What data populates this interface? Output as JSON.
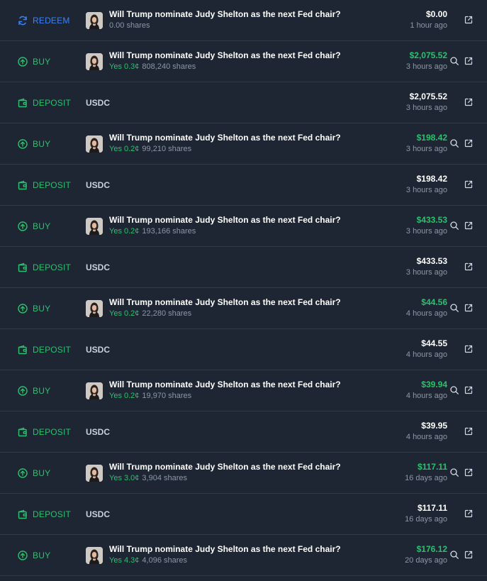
{
  "market_title": "Will Trump nominate Judy Shelton as the next Fed chair?",
  "colors": {
    "buy": "#27c26b",
    "deposit": "#27c26b",
    "redeem": "#3b82f6",
    "text": "#ffffff",
    "muted": "#8b97a8"
  },
  "rows": [
    {
      "type": "redeem",
      "label": "REDEEM",
      "icon": "refresh-icon",
      "title": "Will Trump nominate Judy Shelton as the next Fed chair?",
      "outcome": "",
      "shares": "0.00 shares",
      "amount": "$0.00",
      "time": "1 hour ago"
    },
    {
      "type": "buy",
      "label": "BUY",
      "icon": "arrow-up-circle-icon",
      "title": "Will Trump nominate Judy Shelton as the next Fed chair?",
      "outcome": "Yes 0.3¢",
      "shares": "808,240 shares",
      "amount": "$2,075.52",
      "time": "3 hours ago"
    },
    {
      "type": "deposit",
      "label": "DEPOSIT",
      "icon": "wallet-icon",
      "asset": "USDC",
      "amount": "$2,075.52",
      "time": "3 hours ago"
    },
    {
      "type": "buy",
      "label": "BUY",
      "icon": "arrow-up-circle-icon",
      "title": "Will Trump nominate Judy Shelton as the next Fed chair?",
      "outcome": "Yes 0.2¢",
      "shares": "99,210 shares",
      "amount": "$198.42",
      "time": "3 hours ago"
    },
    {
      "type": "deposit",
      "label": "DEPOSIT",
      "icon": "wallet-icon",
      "asset": "USDC",
      "amount": "$198.42",
      "time": "3 hours ago"
    },
    {
      "type": "buy",
      "label": "BUY",
      "icon": "arrow-up-circle-icon",
      "title": "Will Trump nominate Judy Shelton as the next Fed chair?",
      "outcome": "Yes 0.2¢",
      "shares": "193,166 shares",
      "amount": "$433.53",
      "time": "3 hours ago"
    },
    {
      "type": "deposit",
      "label": "DEPOSIT",
      "icon": "wallet-icon",
      "asset": "USDC",
      "amount": "$433.53",
      "time": "3 hours ago"
    },
    {
      "type": "buy",
      "label": "BUY",
      "icon": "arrow-up-circle-icon",
      "title": "Will Trump nominate Judy Shelton as the next Fed chair?",
      "outcome": "Yes 0.2¢",
      "shares": "22,280 shares",
      "amount": "$44.56",
      "time": "4 hours ago"
    },
    {
      "type": "deposit",
      "label": "DEPOSIT",
      "icon": "wallet-icon",
      "asset": "USDC",
      "amount": "$44.55",
      "time": "4 hours ago"
    },
    {
      "type": "buy",
      "label": "BUY",
      "icon": "arrow-up-circle-icon",
      "title": "Will Trump nominate Judy Shelton as the next Fed chair?",
      "outcome": "Yes 0.2¢",
      "shares": "19,970 shares",
      "amount": "$39.94",
      "time": "4 hours ago"
    },
    {
      "type": "deposit",
      "label": "DEPOSIT",
      "icon": "wallet-icon",
      "asset": "USDC",
      "amount": "$39.95",
      "time": "4 hours ago"
    },
    {
      "type": "buy",
      "label": "BUY",
      "icon": "arrow-up-circle-icon",
      "title": "Will Trump nominate Judy Shelton as the next Fed chair?",
      "outcome": "Yes 3.0¢",
      "shares": "3,904 shares",
      "amount": "$117.11",
      "time": "16 days ago"
    },
    {
      "type": "deposit",
      "label": "DEPOSIT",
      "icon": "wallet-icon",
      "asset": "USDC",
      "amount": "$117.11",
      "time": "16 days ago"
    },
    {
      "type": "buy",
      "label": "BUY",
      "icon": "arrow-up-circle-icon",
      "title": "Will Trump nominate Judy Shelton as the next Fed chair?",
      "outcome": "Yes 4.3¢",
      "shares": "4,096 shares",
      "amount": "$176.12",
      "time": "20 days ago"
    }
  ]
}
